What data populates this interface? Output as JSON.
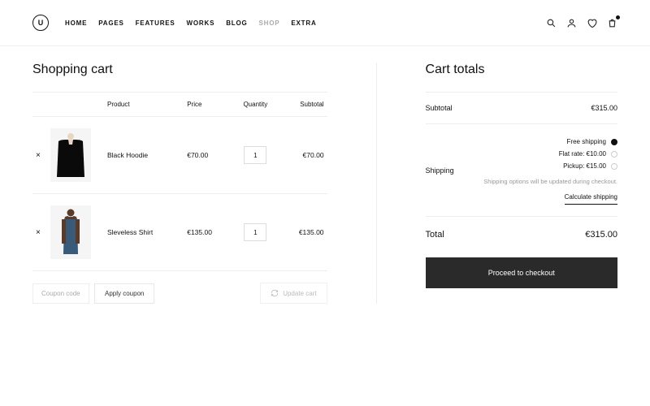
{
  "nav": {
    "items": [
      "HOME",
      "PAGES",
      "FEATURES",
      "WORKS",
      "BLOG",
      "SHOP",
      "EXTRA"
    ],
    "active_index": 5
  },
  "cart": {
    "title": "Shopping cart",
    "columns": {
      "product": "Product",
      "price": "Price",
      "quantity": "Quantity",
      "subtotal": "Subtotal"
    },
    "items": [
      {
        "name": "Black Hoodie",
        "price": "€70.00",
        "qty": "1",
        "subtotal": "€70.00"
      },
      {
        "name": "Sleveless Shirt",
        "price": "€135.00",
        "qty": "1",
        "subtotal": "€135.00"
      }
    ],
    "coupon_placeholder": "Coupon code",
    "apply_label": "Apply coupon",
    "update_label": "Update cart"
  },
  "totals": {
    "title": "Cart totals",
    "subtotal_label": "Subtotal",
    "subtotal_value": "€315.00",
    "shipping_label": "Shipping",
    "options": [
      {
        "label": "Free shipping",
        "selected": true
      },
      {
        "label": "Flat rate: €10.00",
        "selected": false
      },
      {
        "label": "Pickup: €15.00",
        "selected": false
      }
    ],
    "note": "Shipping options will be updated during checkout.",
    "calc_label": "Calculate shipping",
    "total_label": "Total",
    "total_value": "€315.00",
    "checkout_label": "Proceed to checkout"
  }
}
